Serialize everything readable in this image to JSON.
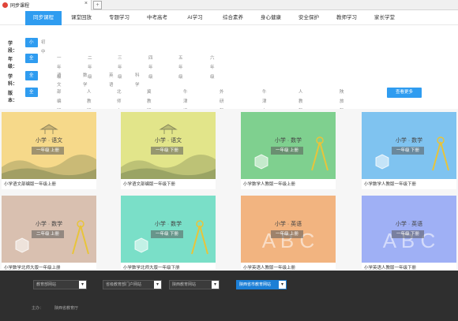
{
  "browser": {
    "tab_title": "同步课程",
    "close": "×",
    "newtab": "+"
  },
  "nav": {
    "items": [
      "同步课程",
      "课堂回放",
      "专题学习",
      "中考高考",
      "AI学习",
      "综合素养",
      "身心健康",
      "安全保护",
      "教师学习",
      "家长学堂"
    ],
    "active_index": 0
  },
  "filters": {
    "stage": {
      "label": "学段：",
      "options": [
        "小学",
        "初中"
      ],
      "selected": 0
    },
    "grade": {
      "label": "年级：",
      "options": [
        "全部",
        "一年级",
        "二年级",
        "三年级",
        "四年级",
        "五年级",
        "六年级"
      ],
      "selected": 0
    },
    "subject": {
      "label": "学科：",
      "options": [
        "全部",
        "语文",
        "数学",
        "英语",
        "科学"
      ],
      "selected": 0
    },
    "edition": {
      "label": "版本：",
      "options": [
        "全部",
        "部编版",
        "人教版",
        "北师大版",
        "冀教版",
        "牛津译林",
        "外研新标准版",
        "牛津上海",
        "人教新起点",
        "陕旅新版"
      ],
      "selected": 0
    },
    "more_button": "查看更多"
  },
  "cards": [
    {
      "subject": "小学 · 语文",
      "grade": "一年级 上册",
      "caption": "小学语文部编版一年级上册",
      "theme": "chinese",
      "bg": "#f6d98a"
    },
    {
      "subject": "小学 · 语文",
      "grade": "一年级 下册",
      "caption": "小学语文部编版一年级下册",
      "theme": "chinese",
      "bg": "#e2e58a"
    },
    {
      "subject": "小学 · 数学",
      "grade": "一年级 上册",
      "caption": "小学数学人教版一年级上册",
      "theme": "math",
      "bg": "#7fd08f"
    },
    {
      "subject": "小学 · 数学",
      "grade": "一年级 下册",
      "caption": "小学数学人教版一年级下册",
      "theme": "math",
      "bg": "#7fc3f0"
    },
    {
      "subject": "小学 · 数学",
      "grade": "二年级 上册",
      "caption": "小学数学北师大版一年级上册",
      "theme": "math",
      "bg": "#d9c0b0"
    },
    {
      "subject": "小学 · 数学",
      "grade": "一年级 下册",
      "caption": "小学数学北师大版一年级下册",
      "theme": "math",
      "bg": "#7adfc8"
    },
    {
      "subject": "小学 · 英语",
      "grade": "一年级 上册",
      "caption": "小学英语人教版一年级上册",
      "theme": "english",
      "bg": "#f2b480"
    },
    {
      "subject": "小学 · 英语",
      "grade": "一年级 下册",
      "caption": "小学英语人教版一年级下册",
      "theme": "english",
      "bg": "#9fb0f5"
    }
  ],
  "footer": {
    "selects": [
      "教育部网站",
      "省级教育部门户网站",
      "陕西教育网站",
      "陕西省市教育网站"
    ],
    "active_select": 3,
    "line1": {
      "label": "主办：",
      "value": "陕西省教育厅"
    }
  },
  "colors": {
    "accent": "#2f9cf0",
    "footer_bg": "#2f2f2f"
  }
}
